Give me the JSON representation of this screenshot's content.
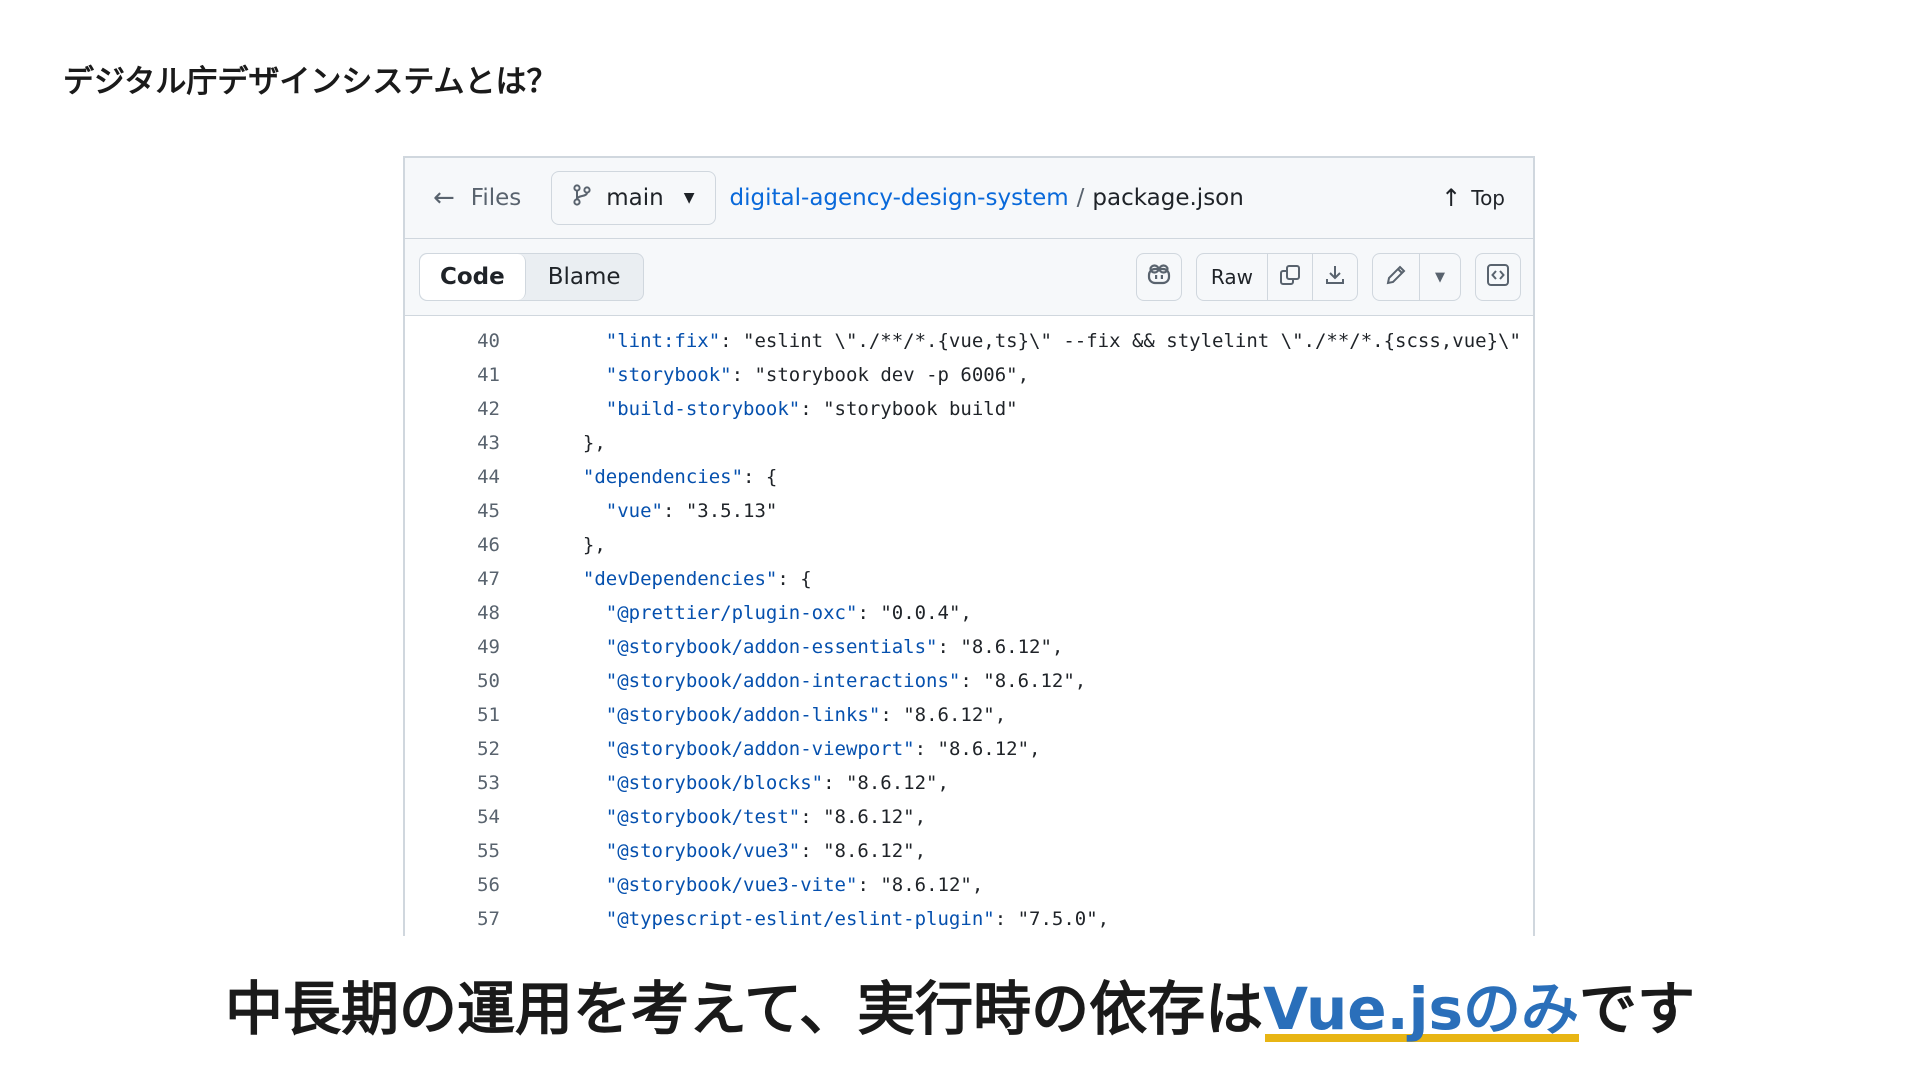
{
  "slide": {
    "title": "デジタル庁デザインシステムとは？",
    "headline_prefix": "中長期の運用を考えて、実行時の依存は",
    "headline_highlight": "Vue.jsのみ",
    "headline_suffix": "です",
    "highlight_color": "#2a6fba",
    "underline_color": "#e8b514"
  },
  "topbar": {
    "back_label": "Files",
    "branch": "main",
    "repo": "digital-agency-design-system",
    "separator": "/",
    "file": "package.json",
    "top_label": "Top"
  },
  "toolbar": {
    "tab_code": "Code",
    "tab_blame": "Blame",
    "raw_label": "Raw",
    "icons": [
      "copilot-icon",
      "copy-icon",
      "download-icon",
      "pencil-icon",
      "chevron-down-icon",
      "symbols-icon"
    ]
  },
  "code_lines": [
    {
      "n": "40",
      "indent": "    ",
      "key": "\"lint:fix\"",
      "rest": ": \"eslint \\\"./**/*.{vue,ts}\\\" --fix && stylelint \\\"./**/*.{scss,vue}\\\" --fix\","
    },
    {
      "n": "41",
      "indent": "    ",
      "key": "\"storybook\"",
      "rest": ": \"storybook dev -p 6006\","
    },
    {
      "n": "42",
      "indent": "    ",
      "key": "\"build-storybook\"",
      "rest": ": \"storybook build\""
    },
    {
      "n": "43",
      "indent": "  ",
      "key": "",
      "rest": "},"
    },
    {
      "n": "44",
      "indent": "  ",
      "key": "\"dependencies\"",
      "rest": ": {"
    },
    {
      "n": "45",
      "indent": "    ",
      "key": "\"vue\"",
      "rest": ": \"3.5.13\""
    },
    {
      "n": "46",
      "indent": "  ",
      "key": "",
      "rest": "},"
    },
    {
      "n": "47",
      "indent": "  ",
      "key": "\"devDependencies\"",
      "rest": ": {"
    },
    {
      "n": "48",
      "indent": "    ",
      "key": "\"@prettier/plugin-oxc\"",
      "rest": ": \"0.0.4\","
    },
    {
      "n": "49",
      "indent": "    ",
      "key": "\"@storybook/addon-essentials\"",
      "rest": ": \"8.6.12\","
    },
    {
      "n": "50",
      "indent": "    ",
      "key": "\"@storybook/addon-interactions\"",
      "rest": ": \"8.6.12\","
    },
    {
      "n": "51",
      "indent": "    ",
      "key": "\"@storybook/addon-links\"",
      "rest": ": \"8.6.12\","
    },
    {
      "n": "52",
      "indent": "    ",
      "key": "\"@storybook/addon-viewport\"",
      "rest": ": \"8.6.12\","
    },
    {
      "n": "53",
      "indent": "    ",
      "key": "\"@storybook/blocks\"",
      "rest": ": \"8.6.12\","
    },
    {
      "n": "54",
      "indent": "    ",
      "key": "\"@storybook/test\"",
      "rest": ": \"8.6.12\","
    },
    {
      "n": "55",
      "indent": "    ",
      "key": "\"@storybook/vue3\"",
      "rest": ": \"8.6.12\","
    },
    {
      "n": "56",
      "indent": "    ",
      "key": "\"@storybook/vue3-vite\"",
      "rest": ": \"8.6.12\","
    },
    {
      "n": "57",
      "indent": "    ",
      "key": "\"@typescript-eslint/eslint-plugin\"",
      "rest": ": \"7.5.0\","
    }
  ]
}
